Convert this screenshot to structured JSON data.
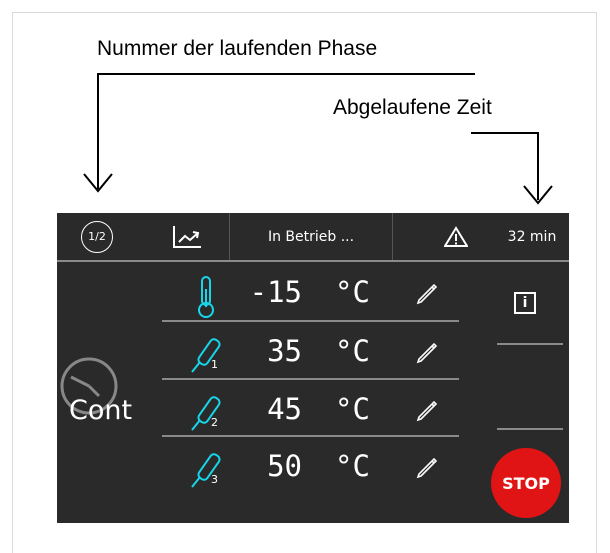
{
  "annotations": {
    "phase_number": "Nummer der laufenden Phase",
    "elapsed_time": "Abgelaufene Zeit"
  },
  "topbar": {
    "phase": "1/2",
    "status": "In Betrieb ...",
    "elapsed": "32 min",
    "icons": [
      "phase-counter-icon",
      "graph-trend-icon",
      "warning-icon"
    ]
  },
  "mode": {
    "label": "Cont",
    "icon": "clock-icon"
  },
  "rows": [
    {
      "icon": "thermometer-icon",
      "sensor_number": "",
      "value": "-15",
      "unit": "°C"
    },
    {
      "icon": "probe-icon",
      "sensor_number": "1",
      "value": "35",
      "unit": "°C"
    },
    {
      "icon": "probe-icon",
      "sensor_number": "2",
      "value": "45",
      "unit": "°C"
    },
    {
      "icon": "probe-icon",
      "sensor_number": "3",
      "value": "50",
      "unit": "°C"
    }
  ],
  "side": {
    "info_label": "i",
    "stop_label": "STOP"
  },
  "colors": {
    "panel_bg": "#2a2a2a",
    "accent_cyan": "#17d6ea",
    "stop_red": "#e01414"
  }
}
